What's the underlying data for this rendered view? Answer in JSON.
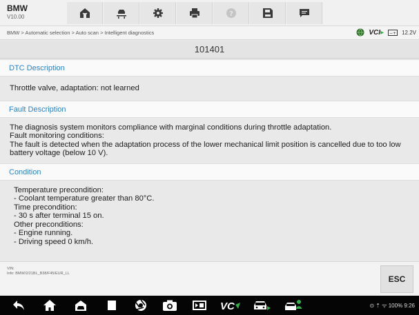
{
  "app": {
    "make": "BMW",
    "version": "V10.00"
  },
  "toolbar": {
    "icons": [
      "home-icon",
      "vehicle-lift-icon",
      "settings-icon",
      "print-icon",
      "help-icon",
      "save-icon",
      "messages-icon"
    ]
  },
  "breadcrumb": "BMW > Automatic selection > Auto scan > Intelligent diagnostics",
  "status": {
    "vci": "VCI",
    "battery_voltage": "12.2V"
  },
  "dtc_code": "101401",
  "sections": {
    "dtc": {
      "title": "DTC Description",
      "text": "Throttle valve, adaptation: not learned"
    },
    "fault": {
      "title": "Fault Description",
      "lines": [
        "The diagnosis system monitors compliance with marginal conditions during throttle adaptation.",
        "Fault monitoring conditions:",
        "The fault is detected when the adaptation process of the lower mechanical limit position is cancelled due to too low battery voltage (below 10 V)."
      ]
    },
    "condition": {
      "title": "Condition",
      "lines": [
        "Temperature precondition:",
        "- Coolant temperature greater than 80°C.",
        "Time precondition:",
        "- 30 s after terminal 15 on.",
        "Other preconditions:",
        "- Engine running.",
        "- Driving speed 0 km/h."
      ]
    }
  },
  "info": {
    "vin_label": "VIN:",
    "info_line": "Info: BMW/2/21BL_B38/F45/EUR_LL"
  },
  "esc_label": "ESC",
  "system_tray": "⊙ ⇡ ᯤ 100% 9:26",
  "navbar": {
    "icons": [
      "back-icon",
      "home-icon",
      "vehicle-home-icon",
      "recents-icon",
      "browser-icon",
      "camera-icon",
      "screen-record-icon",
      "vci-icon",
      "car-icon",
      "car-person-icon"
    ]
  }
}
